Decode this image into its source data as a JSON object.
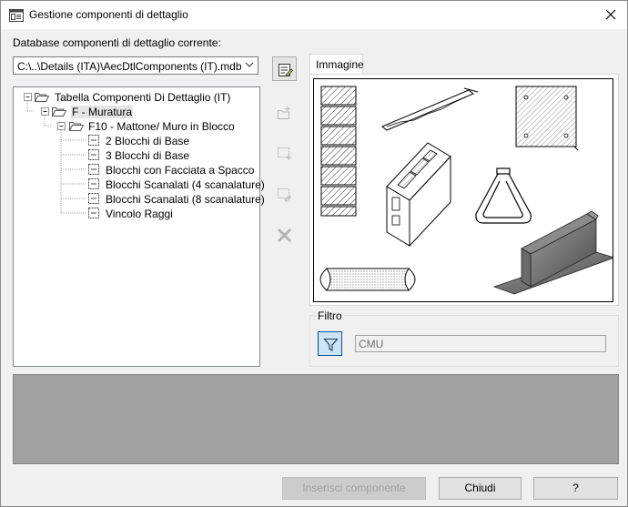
{
  "window": {
    "title": "Gestione componenti di dettaglio"
  },
  "database": {
    "label": "Database componenti di dettaglio corrente:",
    "value": "C:\\..\\Details (ITA)\\AecDtlComponents (IT).mdb"
  },
  "tree": {
    "items": [
      {
        "label": "Tabella Componenti Di Dettaglio (IT)"
      },
      {
        "label": "F - Muratura"
      },
      {
        "label": "F10 - Mattone/ Muro in Blocco"
      },
      {
        "label": "2 Blocchi di Base"
      },
      {
        "label": "3 Blocchi di Base"
      },
      {
        "label": "Blocchi con Facciata a Spacco"
      },
      {
        "label": "Blocchi Scanalati (4 scanalature)"
      },
      {
        "label": "Blocchi Scanalati (8 scanalature)"
      },
      {
        "label": "Vincolo Raggi"
      }
    ]
  },
  "tabs": {
    "image": "Immagine"
  },
  "filter": {
    "legend": "Filtro",
    "value": "CMU"
  },
  "buttons": {
    "insert": "Inserisci componente",
    "close": "Chiudi",
    "help": "?"
  }
}
